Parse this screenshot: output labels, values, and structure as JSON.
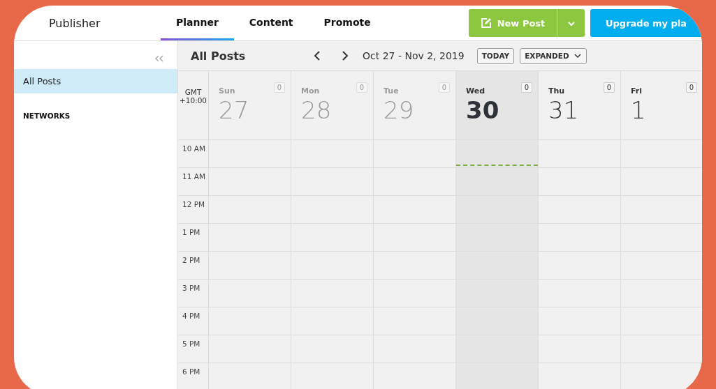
{
  "app": {
    "title": "Publisher"
  },
  "tabs": [
    {
      "label": "Planner",
      "selected": true
    },
    {
      "label": "Content",
      "selected": false
    },
    {
      "label": "Promote",
      "selected": false
    }
  ],
  "actions": {
    "new_post": "New Post",
    "upgrade": "Upgrade my pla"
  },
  "sidebar": {
    "items": [
      {
        "label": "All Posts",
        "selected": true
      }
    ],
    "section": "NETWORKS"
  },
  "toolbar": {
    "title": "All Posts",
    "range": "Oct 27 - Nov 2, 2019",
    "today": "TODAY",
    "view": "EXPANDED"
  },
  "timezone": [
    "GMT",
    "+10:00"
  ],
  "days": [
    {
      "name": "Sun",
      "date": "27",
      "count": "0",
      "kind": "past"
    },
    {
      "name": "Mon",
      "date": "28",
      "count": "0",
      "kind": "past"
    },
    {
      "name": "Tue",
      "date": "29",
      "count": "0",
      "kind": "past"
    },
    {
      "name": "Wed",
      "date": "30",
      "count": "0",
      "kind": "today"
    },
    {
      "name": "Thu",
      "date": "31",
      "count": "0",
      "kind": "future"
    },
    {
      "name": "Fri",
      "date": "1",
      "count": "0",
      "kind": "future"
    }
  ],
  "hours": [
    "10 AM",
    "11 AM",
    "12 PM",
    "1 PM",
    "2 PM",
    "3 PM",
    "4 PM",
    "5 PM",
    "6 PM"
  ]
}
